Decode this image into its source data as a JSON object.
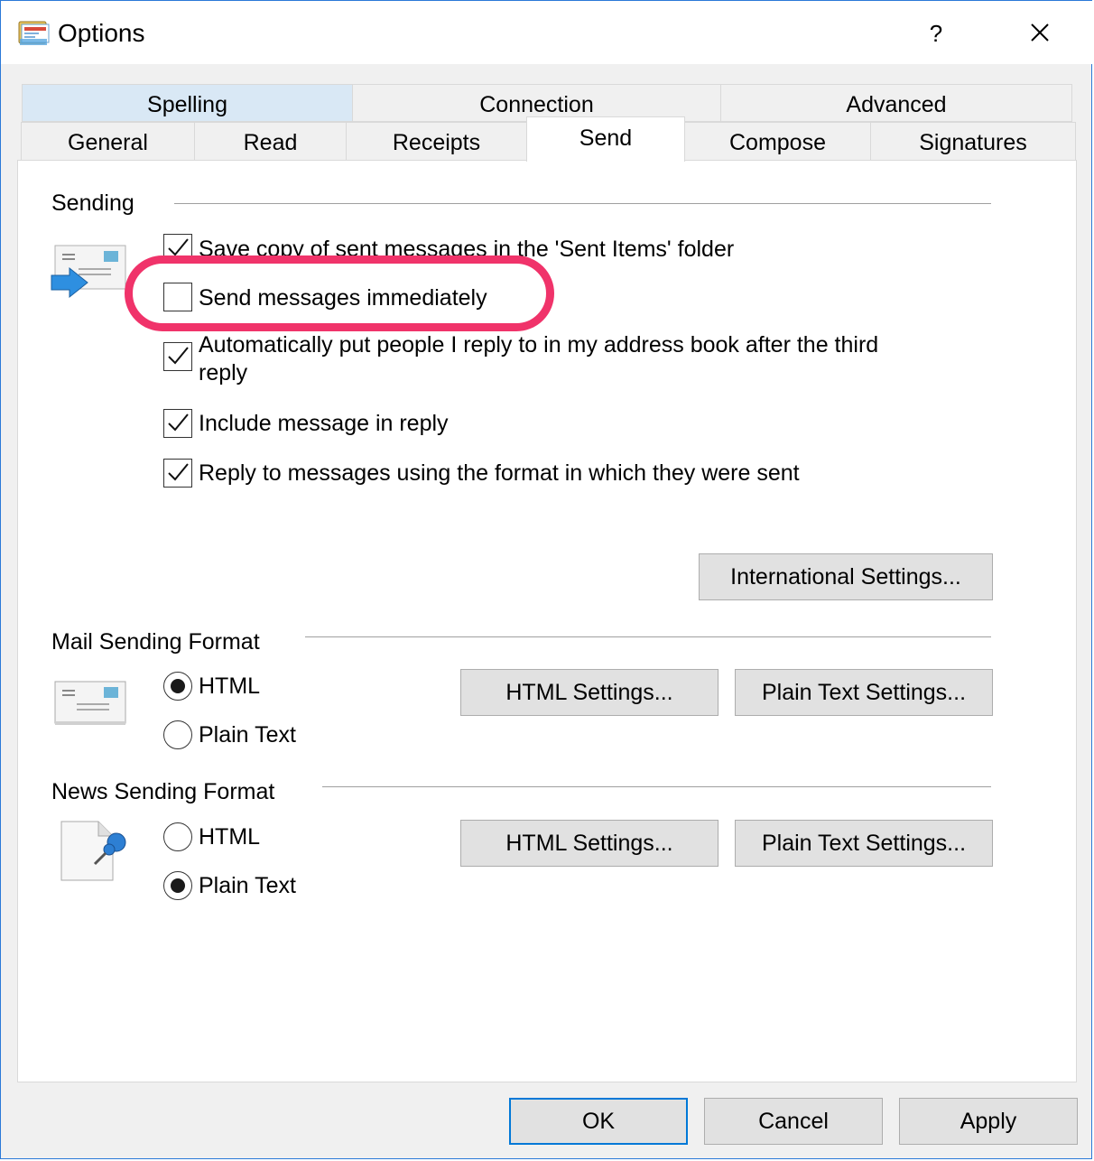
{
  "window": {
    "title": "Options",
    "help_label": "?"
  },
  "tabs": {
    "row1": [
      {
        "label": "Spelling"
      },
      {
        "label": "Connection"
      },
      {
        "label": "Advanced"
      }
    ],
    "row2": [
      {
        "label": "General"
      },
      {
        "label": "Read"
      },
      {
        "label": "Receipts"
      },
      {
        "label": "Send"
      },
      {
        "label": "Compose"
      },
      {
        "label": "Signatures"
      }
    ],
    "active": "Send"
  },
  "sending": {
    "label": "Sending",
    "options": [
      {
        "label": "Save copy of sent messages in the 'Sent Items' folder",
        "checked": true
      },
      {
        "label": "Send messages immediately",
        "checked": false
      },
      {
        "label": "Automatically put people I reply to in my address book after the third reply",
        "checked": true
      },
      {
        "label": "Include message in reply",
        "checked": true
      },
      {
        "label": "Reply to messages using the format in which they were sent",
        "checked": true
      }
    ],
    "intl_button": "International Settings..."
  },
  "mail_format": {
    "label": "Mail Sending Format",
    "options": [
      {
        "label": "HTML",
        "selected": true
      },
      {
        "label": "Plain Text",
        "selected": false
      }
    ],
    "html_button": "HTML Settings...",
    "plain_button": "Plain Text Settings..."
  },
  "news_format": {
    "label": "News Sending Format",
    "options": [
      {
        "label": "HTML",
        "selected": false
      },
      {
        "label": "Plain Text",
        "selected": true
      }
    ],
    "html_button": "HTML Settings...",
    "plain_button": "Plain Text Settings..."
  },
  "footer": {
    "ok": "OK",
    "cancel": "Cancel",
    "apply": "Apply"
  },
  "colors": {
    "highlight_ring": "#f0336a",
    "accent": "#0078d7",
    "tab_highlight": "#d9e8f5"
  }
}
